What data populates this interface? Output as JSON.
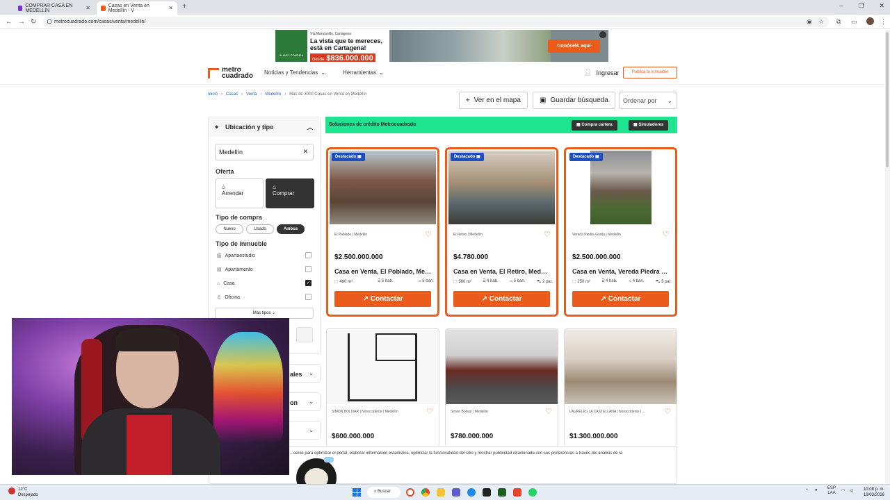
{
  "browser": {
    "tabs": [
      {
        "title": "COMPRAR CASA EN MEDELLIN"
      },
      {
        "title": "Casas en Venta en Medellín - V"
      }
    ],
    "new_tab": "+",
    "url": "metrocuadrado.com/casas/venta/medellin/",
    "controls": {
      "minimize": "–",
      "maximize": "❐",
      "close": "✕"
    }
  },
  "ad": {
    "logo_text": "IN AVEL CONDIDA",
    "location": "Vía Manzanillo, Cartagena",
    "headline": "La vista que te mereces, está en Cartagena!",
    "price_prefix": "Desde",
    "price": "$836.000.000",
    "cta": "Conócelo aquí"
  },
  "header": {
    "logo_line1": "metro",
    "logo_line2": "cuadrado",
    "nav": [
      "Noticias y Tendencias",
      "Herramientas"
    ],
    "login": "Ingresar",
    "publish": "Publica tu inmueble"
  },
  "breadcrumb": {
    "items": [
      "Inicio",
      "Casas",
      "Venta",
      "Medellín"
    ],
    "current": "Más de 3000 Casas en Venta en Medellín"
  },
  "actions": {
    "map": "Ver en el mapa",
    "save": "Guardar búsqueda",
    "sort": "Ordenar por"
  },
  "filters": {
    "section_title": "Ubicación y tipo",
    "location_value": "Medellín",
    "oferta_label": "Oferta",
    "oferta_options": [
      "Arrendar",
      "Comprar"
    ],
    "tipo_compra_label": "Tipo de compra",
    "tipo_compra_options": [
      "Nuevo",
      "Usado",
      "Ambos"
    ],
    "tipo_inmueble_label": "Tipo de inmueble",
    "tipo_inmueble": [
      {
        "label": "Apartaestudio",
        "checked": false
      },
      {
        "label": "Apartamento",
        "checked": false
      },
      {
        "label": "Casa",
        "checked": true
      },
      {
        "label": "Oficina",
        "checked": false
      }
    ],
    "more_types": "Más tipos",
    "partial_labels": [
      "ales",
      "on"
    ]
  },
  "promo": {
    "text": "Soluciones de crédito Metrocuadrado",
    "btn1": "Compra cartera",
    "btn2": "Simuladores"
  },
  "featured": [
    {
      "badge": "Destacado",
      "location": "El Poblado | Medellín",
      "price": "$2.500.000.000",
      "title": "Casa en Venta, El Poblado, Medellín",
      "area": "480 m²",
      "rooms": "5 hab.",
      "baths": "5 ban.",
      "parking": "",
      "cta": "Contactar"
    },
    {
      "badge": "Destacado",
      "location": "El Retiro | Medellín",
      "price": "$4.780.000",
      "title": "Casa en Venta, El Retiro, Medellín",
      "area": "560 m²",
      "rooms": "4 hab.",
      "baths": "5 ban.",
      "parking": "2 par.",
      "cta": "Contactar"
    },
    {
      "badge": "Destacado",
      "location": "Vereda Piedra Gorda | Medellín",
      "price": "$2.500.000.000",
      "title": "Casa en Venta, Vereda Piedra Gorda",
      "area": "250 m²",
      "rooms": "4 hab.",
      "baths": "4 ban.",
      "parking": "3 par.",
      "cta": "Contactar"
    }
  ],
  "listings": [
    {
      "location": "SIMON BOLIVAR | Noroccidente | Medellín",
      "price": "$600.000.000"
    },
    {
      "location": "Simon Bolivar | Medellín",
      "price": "$780.000.000"
    },
    {
      "location": "LAURELES LA CASTELLANA | Noroccidente | ...",
      "price": "$1.300.000.000"
    }
  ],
  "cookie": {
    "text": "...ceros para optimizar el portal, elaborar información estadística, optimizar la funcionalidad del sitio y mostrar publicidad relacionada con sus preferencias a través del análisis de la"
  },
  "taskbar": {
    "temp": "12°C",
    "weather": "Despejado",
    "search": "Buscar",
    "lang1": "ESP",
    "lang2": "LAA",
    "time": "10:08 p. m.",
    "date": "19/03/2026"
  },
  "colors": {
    "brand_orange": "#ea5b1c",
    "promo_green": "#1ee38f",
    "badge_blue": "#1f4fbf"
  }
}
